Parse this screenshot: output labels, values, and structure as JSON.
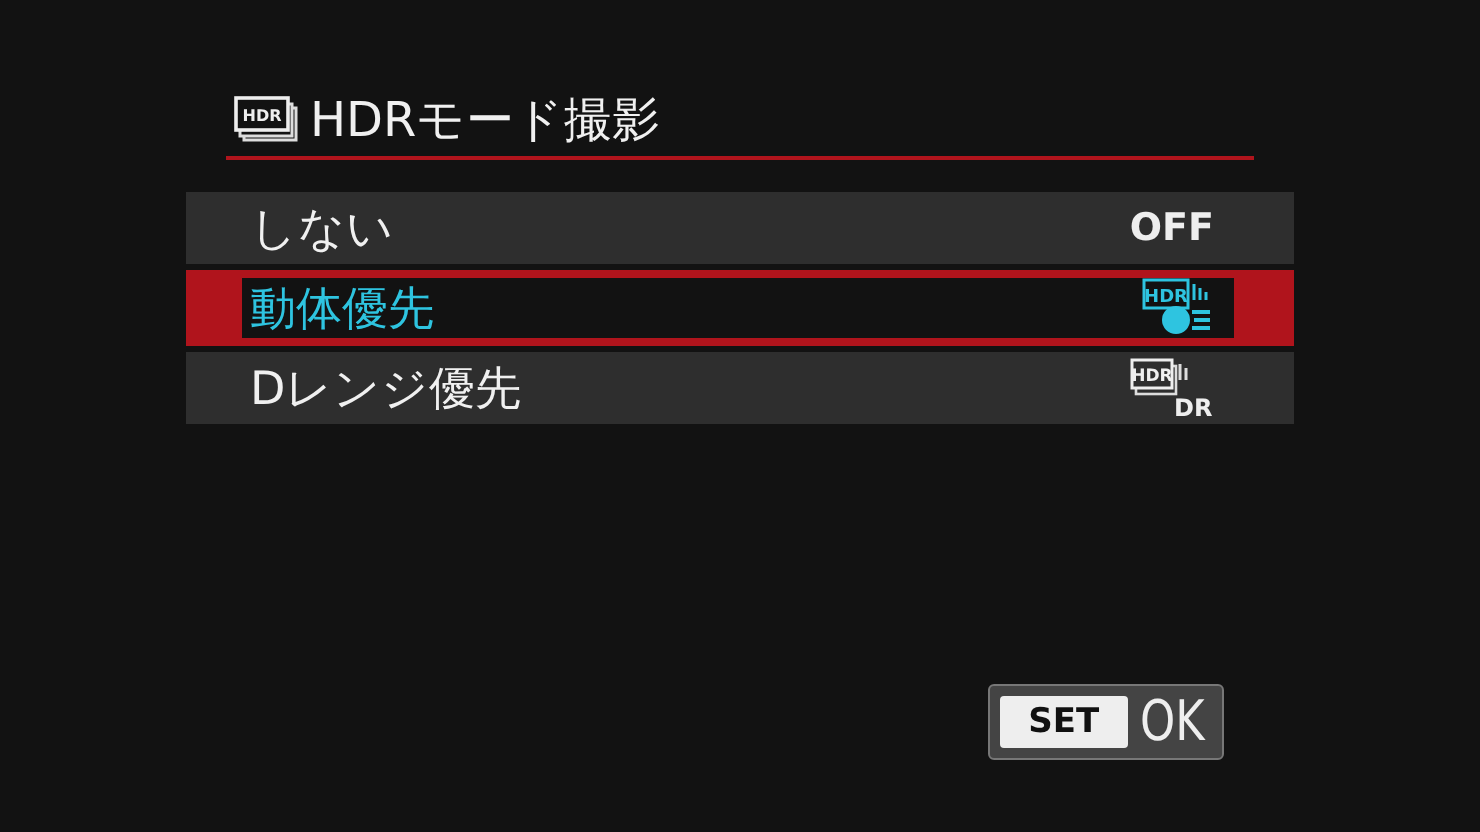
{
  "title": {
    "icon_text": "HDR",
    "text": "HDRモード撮影"
  },
  "options": [
    {
      "label": "しない",
      "selected": false,
      "kind": "text",
      "value": "OFF"
    },
    {
      "label": "動体優先",
      "selected": true,
      "kind": "motion",
      "icon_text": "HDR"
    },
    {
      "label": "Dレンジ優先",
      "selected": false,
      "kind": "drange",
      "icon_text": "HDR",
      "icon_sub": "DR"
    }
  ],
  "confirm": {
    "key": "SET",
    "label": "OK"
  }
}
